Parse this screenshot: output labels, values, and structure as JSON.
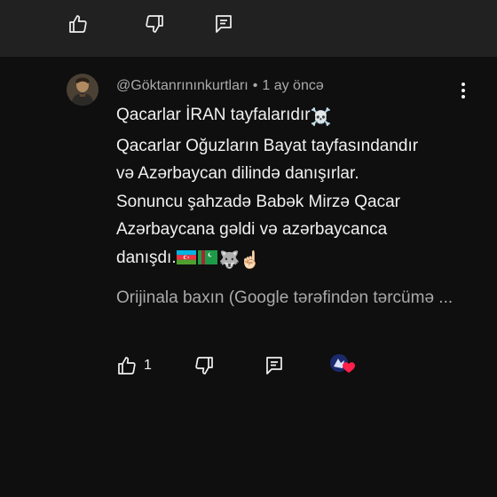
{
  "top_actions": {
    "like_icon": "thumbs-up-icon",
    "dislike_icon": "thumbs-down-icon",
    "reply_icon": "comment-reply-icon"
  },
  "comment": {
    "author": "@Göktanrınınkurtları",
    "separator": "•",
    "time": "1 ay öncə",
    "lines": [
      "Qacarlar İRAN tayfalarıdır",
      "Qacarlar Oğuzların Bayat tayfasındandır",
      "və Azərbaycan dilində danışırlar.",
      "Sonuncu şahzadə Babək Mirzə Qacar",
      "Azərbaycana gəldi və azərbaycanca",
      "danışdı."
    ],
    "emoji": {
      "skull": "☠️",
      "wolf": "🐺",
      "finger": "☝🏻"
    },
    "translate": "Orijinala baxın (Google tərəfindən tərcümə ...",
    "like_count": "1"
  },
  "colors": {
    "background": "#0f0f0f",
    "top_bar": "#212121",
    "text": "#f1f1f1",
    "secondary": "#aaaaaa",
    "heart": "#ff1f4b"
  }
}
